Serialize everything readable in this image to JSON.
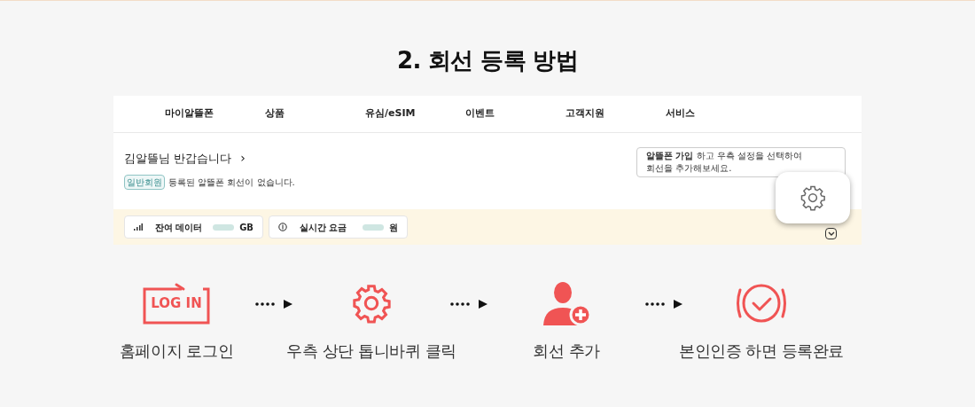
{
  "title": "2. 회선 등록 방법",
  "screenshot": {
    "nav": [
      "마이알뜰폰",
      "상품",
      "유심/eSIM",
      "이벤트",
      "고객지원",
      "서비스"
    ],
    "greeting": "김알뜰님 반갑습니다",
    "greeting_arrow": "›",
    "badge": "일반회원",
    "message": "등록된 알뜰폰 회선이 없습니다.",
    "tip": "**알뜰폰 가입** 하고 우측 설정을 선택하여\n회선을 추가해보세요.",
    "cards": [
      {
        "kind": "data",
        "label": "잔여 데이터",
        "unit": "GB"
      },
      {
        "kind": "fee",
        "label": "실시간 요금",
        "unit": "원"
      }
    ]
  },
  "steps": [
    {
      "kind": "login",
      "icon_text": "LOG IN",
      "label": "홈페이지 로그인"
    },
    {
      "kind": "gear",
      "label": "우측 상단 톱니바퀴 클릭"
    },
    {
      "kind": "user-add",
      "label": "회선 추가"
    },
    {
      "kind": "check",
      "label": "본인인증 하면 등록완료"
    }
  ]
}
